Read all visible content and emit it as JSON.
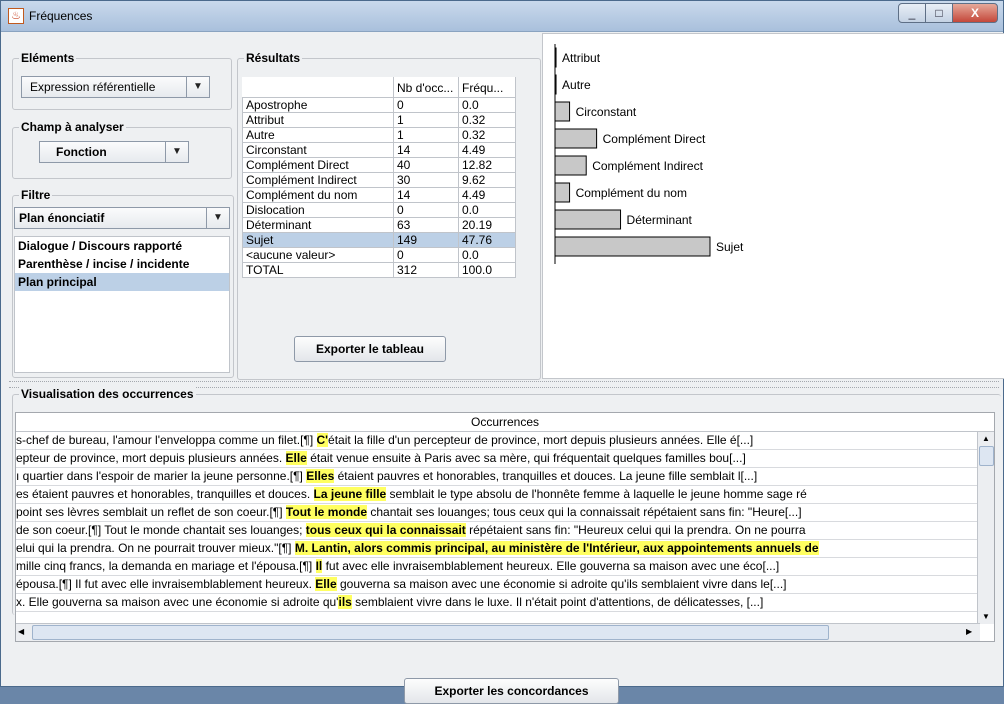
{
  "window": {
    "title": "Fréquences",
    "min": "_",
    "max": "□",
    "close": "X"
  },
  "elements": {
    "title": "Eléments",
    "combo_value": "Expression référentielle"
  },
  "champ": {
    "title": "Champ à analyser",
    "combo_value": "Fonction"
  },
  "filtre": {
    "title": "Filtre",
    "combo_value": "Plan énonciatif",
    "list": [
      "Dialogue / Discours rapporté",
      "Parenthèse / incise / incidente",
      "Plan principal"
    ]
  },
  "results": {
    "title": "Résultats",
    "col1": "Nb d'occ...",
    "col2": "Fréqu...",
    "rows": [
      {
        "name": "Apostrophe",
        "n": "0",
        "f": "0.0"
      },
      {
        "name": "Attribut",
        "n": "1",
        "f": "0.32"
      },
      {
        "name": "Autre",
        "n": "1",
        "f": "0.32"
      },
      {
        "name": "Circonstant",
        "n": "14",
        "f": "4.49"
      },
      {
        "name": "Complément Direct",
        "n": "40",
        "f": "12.82"
      },
      {
        "name": "Complément Indirect",
        "n": "30",
        "f": "9.62"
      },
      {
        "name": "Complément du nom",
        "n": "14",
        "f": "4.49"
      },
      {
        "name": "Dislocation",
        "n": "0",
        "f": "0.0"
      },
      {
        "name": "Déterminant",
        "n": "63",
        "f": "20.19"
      },
      {
        "name": "Sujet",
        "n": "149",
        "f": "47.76"
      },
      {
        "name": "<aucune valeur>",
        "n": "0",
        "f": "0.0"
      },
      {
        "name": "TOTAL",
        "n": "312",
        "f": "100.0"
      }
    ],
    "export_label": "Exporter le tableau"
  },
  "chart_data": {
    "type": "bar",
    "orientation": "horizontal",
    "categories": [
      "Attribut",
      "Autre",
      "Circonstant",
      "Complément Direct",
      "Complément Indirect",
      "Complément du nom",
      "Déterminant",
      "Sujet"
    ],
    "values": [
      1,
      1,
      14,
      40,
      30,
      14,
      63,
      149
    ],
    "bar_color": "#c8c8c8"
  },
  "occurrences": {
    "title": "Visualisation des occurrences",
    "header": "Occurrences",
    "rows": [
      {
        "pre": "s-chef de bureau, l'amour l'enveloppa comme un filet.[¶]   ",
        "hl": "C'",
        "post": "était la fille d'un percepteur de province, mort depuis plusieurs années. Elle é[...]"
      },
      {
        "pre": "epteur de province, mort depuis plusieurs années. ",
        "hl": "Elle",
        "post": " était venue ensuite à Paris avec sa mère, qui fréquentait quelques familles bou[...]"
      },
      {
        "pre": "ı quartier dans l'espoir de marier la jeune personne.[¶]   ",
        "hl": "Elles",
        "post": " étaient pauvres et honorables, tranquilles et douces. La jeune fille semblait l[...]"
      },
      {
        "pre": "es étaient pauvres et honorables, tranquilles et douces. ",
        "hl": "La jeune fille",
        "post": " semblait le type absolu de l'honnête femme à laquelle le jeune homme sage ré"
      },
      {
        "pre": "point ses lèvres semblait un reflet de son coeur.[¶]   ",
        "hl": "Tout le monde",
        "post": " chantait ses louanges; tous ceux qui la connaissait répétaient sans fin: \"Heure[...]"
      },
      {
        "pre": "de son coeur.[¶]   Tout le monde chantait ses louanges; ",
        "hl": "tous ceux qui la connaissait",
        "post": " répétaient sans fin: \"Heureux celui qui la prendra. On ne pourra"
      },
      {
        "pre": "elui qui la prendra. On ne pourrait trouver mieux.\"[¶]   ",
        "hl": "M. Lantin, alors commis principal, au ministère de l'Intérieur, aux appointements annuels de",
        "post": ""
      },
      {
        "pre": "mille cinq francs, la demanda en mariage et l'épousa.[¶]   ",
        "hl": "Il",
        "post": " fut avec elle invraisemblablement heureux. Elle gouverna sa maison avec une éco[...]"
      },
      {
        "pre": "épousa.[¶]   Il fut avec elle invraisemblablement heureux. ",
        "hl": "Elle",
        "post": " gouverna sa maison avec une économie si adroite qu'ils semblaient vivre dans le[...]"
      },
      {
        "pre": "x. Elle gouverna sa maison avec une économie si adroite qu'",
        "hl": "ils",
        "post": " semblaient vivre dans le luxe. Il n'était point d'attentions, de délicatesses, [...]"
      }
    ],
    "export_label": "Exporter les concordances"
  },
  "icons": {
    "app": "java-cup-icon",
    "combo_arrow": "triangle-down-icon"
  }
}
